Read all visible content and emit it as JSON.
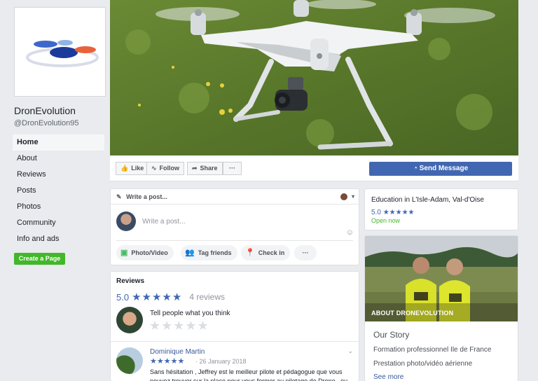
{
  "page": {
    "name": "DronEvolution",
    "handle": "@DronEvolution95"
  },
  "left_nav": {
    "items": [
      "Home",
      "About",
      "Reviews",
      "Posts",
      "Photos",
      "Community",
      "Info and ads"
    ],
    "active": "Home",
    "create_page_label": "Create a Page"
  },
  "actions": {
    "like": "Like",
    "follow": "Follow",
    "share": "Share",
    "more": "···",
    "send_message": "Send Message"
  },
  "composer": {
    "header": "Write a post...",
    "placeholder": "Write a post...",
    "buttons": [
      "Photo/Video",
      "Tag friends",
      "Check in"
    ],
    "more": "···"
  },
  "reviews": {
    "title": "Reviews",
    "score": "5.0",
    "stars": "★★★★★",
    "count_text": "4 reviews",
    "prompt": "Tell people what you think",
    "empty_stars": "★★★★★",
    "items": [
      {
        "author": "Dominique Martin",
        "stars": "★★★★★",
        "date": "· 26 January 2018",
        "text": "Sans hésitation , Jeffrey est le meilleur pilote et pédagogue que vous pouvez trouver sur la place pour vous former au pilotage de Drone , ou"
      }
    ]
  },
  "info": {
    "category": "Education in L'Isle-Adam, Val-d'Oise",
    "rating": "5.0",
    "stars": "★★★★★",
    "status": "Open now"
  },
  "about": {
    "photo_label": "ABOUT DRONEVOLUTION",
    "story_title": "Our Story",
    "lines": [
      "Formation professionnel Ile de France",
      "Prestation photo/vidéo aérienne"
    ],
    "see_more": "See more"
  },
  "colors": {
    "brand_blue": "#4267b2",
    "green": "#42b72a",
    "background": "#e9ebee"
  }
}
